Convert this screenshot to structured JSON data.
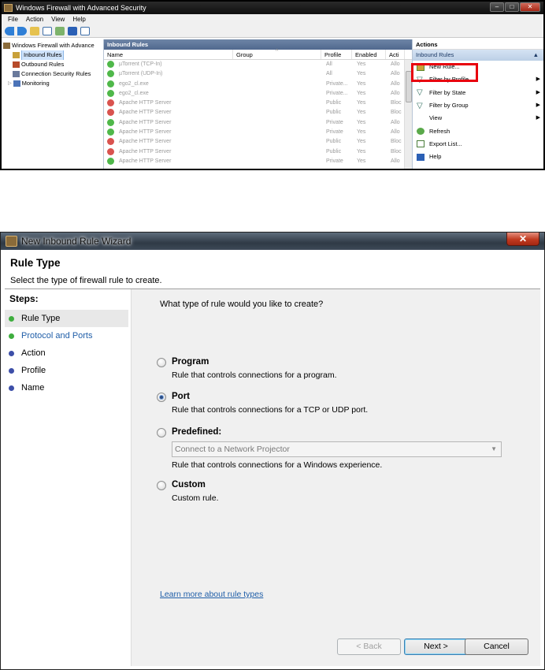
{
  "mmc": {
    "title": "Windows Firewall with Advanced Security",
    "window_controls": [
      "–",
      "□",
      "✕"
    ],
    "menu": [
      "File",
      "Action",
      "View",
      "Help"
    ],
    "tree": [
      {
        "label": "Windows Firewall with Advance",
        "icon": "firewall-icon",
        "selected": false
      },
      {
        "label": "Inbound Rules",
        "icon": "inbound-rules-icon",
        "selected": true
      },
      {
        "label": "Outbound Rules",
        "icon": "outbound-rules-icon",
        "selected": false
      },
      {
        "label": "Connection Security Rules",
        "icon": "connection-security-icon",
        "selected": false
      },
      {
        "label": "Monitoring",
        "icon": "monitoring-icon",
        "selected": false
      }
    ],
    "rules_pane": {
      "header": "Inbound Rules",
      "columns": [
        "Name",
        "Group",
        "Profile",
        "Enabled",
        "Acti"
      ],
      "rows": [
        {
          "name": "µTorrent (TCP-In)",
          "profile": "All",
          "enabled": "Yes",
          "action": "Allo",
          "status": "allow"
        },
        {
          "name": "µTorrent (UDP-In)",
          "profile": "All",
          "enabled": "Yes",
          "action": "Allo",
          "status": "allow"
        },
        {
          "name": "ego2_cl.exe",
          "profile": "Private...",
          "enabled": "Yes",
          "action": "Allo",
          "status": "allow"
        },
        {
          "name": "ego2_cl.exe",
          "profile": "Private...",
          "enabled": "Yes",
          "action": "Allo",
          "status": "allow"
        },
        {
          "name": "Apache HTTP Server",
          "profile": "Public",
          "enabled": "Yes",
          "action": "Bloc",
          "status": "block"
        },
        {
          "name": "Apache HTTP Server",
          "profile": "Public",
          "enabled": "Yes",
          "action": "Bloc",
          "status": "block"
        },
        {
          "name": "Apache HTTP Server",
          "profile": "Private",
          "enabled": "Yes",
          "action": "Allo",
          "status": "allow"
        },
        {
          "name": "Apache HTTP Server",
          "profile": "Private",
          "enabled": "Yes",
          "action": "Allo",
          "status": "allow"
        },
        {
          "name": "Apache HTTP Server",
          "profile": "Public",
          "enabled": "Yes",
          "action": "Bloc",
          "status": "block"
        },
        {
          "name": "Apache HTTP Server",
          "profile": "Public",
          "enabled": "Yes",
          "action": "Bloc",
          "status": "block"
        },
        {
          "name": "Apache HTTP Server",
          "profile": "Private",
          "enabled": "Yes",
          "action": "Allo",
          "status": "allow"
        }
      ]
    },
    "actions_pane": {
      "header": "Actions",
      "subheader": "Inbound Rules",
      "items": [
        {
          "label": "New Rule...",
          "icon": "new-rule-icon",
          "submenu": false
        },
        {
          "label": "Filter by Profile",
          "icon": "filter-icon",
          "submenu": true
        },
        {
          "label": "Filter by State",
          "icon": "filter-icon",
          "submenu": true
        },
        {
          "label": "Filter by Group",
          "icon": "filter-icon",
          "submenu": true
        },
        {
          "label": "View",
          "icon": "",
          "submenu": true
        },
        {
          "label": "Refresh",
          "icon": "refresh-icon",
          "submenu": false
        },
        {
          "label": "Export List...",
          "icon": "export-icon",
          "submenu": false
        },
        {
          "label": "Help",
          "icon": "help-icon",
          "submenu": false
        }
      ]
    }
  },
  "wizard": {
    "title": "New Inbound Rule Wizard",
    "close_glyph": "✕",
    "heading": "Rule Type",
    "subheading": "Select the type of firewall rule to create.",
    "steps_title": "Steps:",
    "steps": [
      {
        "label": "Rule Type",
        "state": "current"
      },
      {
        "label": "Protocol and Ports",
        "state": "link"
      },
      {
        "label": "Action",
        "state": "pending"
      },
      {
        "label": "Profile",
        "state": "pending"
      },
      {
        "label": "Name",
        "state": "pending"
      }
    ],
    "question": "What type of rule would you like to create?",
    "options": [
      {
        "label": "Program",
        "description": "Rule that controls connections for a program.",
        "selected": false
      },
      {
        "label": "Port",
        "description": "Rule that controls connections for a TCP or UDP port.",
        "selected": true
      },
      {
        "label": "Predefined:",
        "description": "Rule that controls connections for a Windows experience.",
        "selected": false
      },
      {
        "label": "Custom",
        "description": "Custom rule.",
        "selected": false
      }
    ],
    "predefined_select_value": "Connect to a Network Projector",
    "learn_more": "Learn more about rule types",
    "buttons": {
      "back": "< Back",
      "next": "Next >",
      "cancel": "Cancel"
    }
  },
  "colors": {
    "highlight": "#e8000d",
    "allow": "#4fb84a",
    "block": "#d9534f",
    "link": "#1f5ea8"
  }
}
